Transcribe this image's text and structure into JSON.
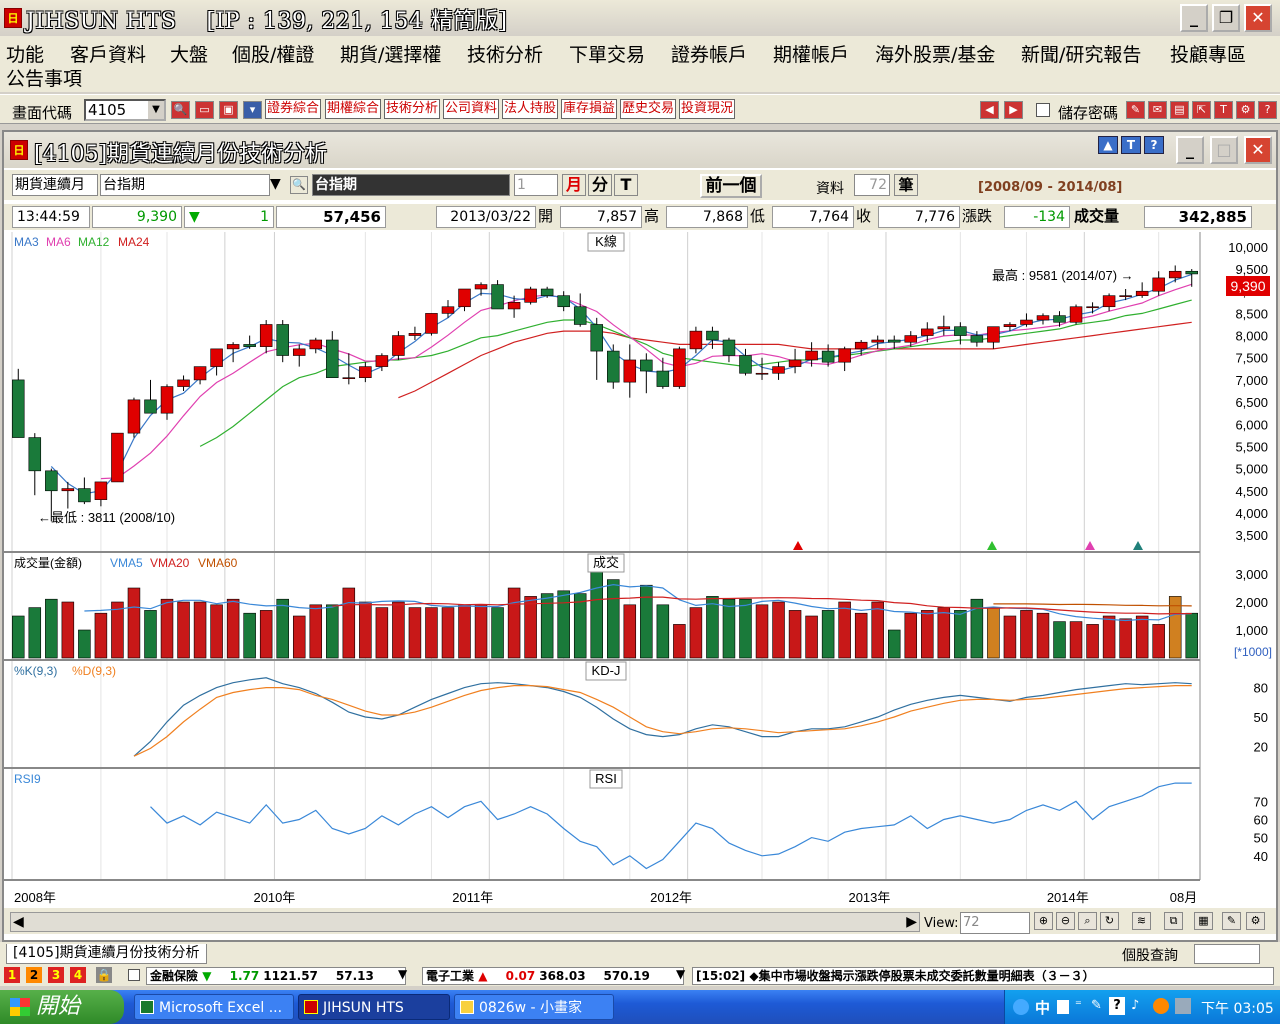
{
  "app": {
    "title": "JIHSUN HTS",
    "subtitle": "[IP : 139, 221, 154 精簡版]",
    "icon": "app-logo-icon"
  },
  "menu": [
    "功能",
    "客戶資料",
    "大盤",
    "個股/權證",
    "期貨/選擇權",
    "技術分析",
    "下單交易",
    "證券帳戶",
    "期權帳戶",
    "海外股票/基金",
    "新聞/研究報告",
    "投顧專區",
    "公告事項"
  ],
  "toolbar": {
    "code_label": "畫面代碼",
    "code_value": "4105",
    "shortcuts": [
      "證券綜合",
      "期權綜合",
      "技術分析",
      "公司資料",
      "法人持股",
      "庫存損益",
      "歷史交易",
      "投資現況"
    ],
    "save_password": "儲存密碼"
  },
  "child": {
    "title": "[4105]期貨連續月份技術分析",
    "type_select": "期貨連續月",
    "symbol_select": "台指期",
    "symbol_name": "台指期",
    "period_value": "1",
    "period_month": "月",
    "period_minute": "分",
    "period_tick": "T",
    "prev_button": "前一個",
    "data_label": "資料",
    "data_count": "72",
    "data_unit": "筆",
    "date_range": "[2008/09 - 2014/08]"
  },
  "quote": {
    "time": "13:44:59",
    "price": "9,390",
    "change_arrow": "▼",
    "change_qty": "1",
    "total": "57,456",
    "date": "2013/03/22",
    "open_label": "開",
    "open": "7,857",
    "high_label": "高",
    "high": "7,868",
    "low_label": "低",
    "low": "7,764",
    "close_label": "收",
    "close": "7,776",
    "change_label": "漲跌",
    "change": "-134",
    "volume_label": "成交量",
    "volume": "342,885"
  },
  "panels": {
    "k": {
      "legend": [
        "MA3",
        "MA6",
        "MA12",
        "MA24"
      ],
      "label": "K線",
      "high_note": "最高 : 9581 (2014/07)",
      "low_note": "最低 : 3811 (2008/10)",
      "last_price": "9,390"
    },
    "vol": {
      "legend_main": "成交量(金額)",
      "legend": [
        "VMA5",
        "VMA20",
        "VMA60"
      ],
      "label": "成交",
      "unit": "[*1000]"
    },
    "kd": {
      "legend": [
        "%K(9,3)",
        "%D(9,3)"
      ],
      "label": "KD-J"
    },
    "rsi": {
      "legend": [
        "RSI9"
      ],
      "label": "RSI"
    }
  },
  "colors": {
    "up": "#e00000",
    "down": "#1a7a3a",
    "ma3": "#3a78c8",
    "ma6": "#e040b0",
    "ma12": "#30b030",
    "ma24": "#d02020",
    "k": "#3070a0",
    "d": "#f08020"
  },
  "chart_data": [
    {
      "type": "candlestick",
      "title": "K線",
      "x": [
        "2008/09",
        "2008/10",
        "2008/11",
        "2008/12",
        "2009/01",
        "2009/02",
        "2009/03",
        "2009/04",
        "2009/05",
        "2009/06",
        "2009/07",
        "2009/08",
        "2009/09",
        "2009/10",
        "2009/11",
        "2009/12",
        "2010/01",
        "2010/02",
        "2010/03",
        "2010/04",
        "2010/05",
        "2010/06",
        "2010/07",
        "2010/08",
        "2010/09",
        "2010/10",
        "2010/11",
        "2010/12",
        "2011/01",
        "2011/02",
        "2011/03",
        "2011/04",
        "2011/05",
        "2011/06",
        "2011/07",
        "2011/08",
        "2011/09",
        "2011/10",
        "2011/11",
        "2011/12",
        "2012/01",
        "2012/02",
        "2012/03",
        "2012/04",
        "2012/05",
        "2012/06",
        "2012/07",
        "2012/08",
        "2012/09",
        "2012/10",
        "2012/11",
        "2012/12",
        "2013/01",
        "2013/02",
        "2013/03",
        "2013/04",
        "2013/05",
        "2013/06",
        "2013/07",
        "2013/08",
        "2013/09",
        "2013/10",
        "2013/11",
        "2013/12",
        "2014/01",
        "2014/02",
        "2014/03",
        "2014/04",
        "2014/05",
        "2014/06",
        "2014/07",
        "2014/08"
      ],
      "open": [
        7000,
        5700,
        4950,
        4500,
        4550,
        4300,
        4700,
        5800,
        6550,
        6250,
        6850,
        7000,
        7300,
        7700,
        7800,
        7750,
        8250,
        7550,
        7700,
        7900,
        7050,
        7050,
        7300,
        7550,
        8000,
        8050,
        8500,
        8650,
        9050,
        9150,
        8600,
        8750,
        9050,
        8900,
        8650,
        8250,
        7650,
        6950,
        7450,
        7200,
        6850,
        7700,
        8100,
        7900,
        7550,
        7150,
        7150,
        7300,
        7450,
        7650,
        7400,
        7700,
        7850,
        7900,
        7850,
        8000,
        8150,
        8200,
        8000,
        7850,
        8200,
        8250,
        8350,
        8450,
        8300,
        8650,
        8650,
        8900,
        8900,
        9000,
        9300,
        9450
      ],
      "high": [
        7250,
        5800,
        5000,
        4700,
        4800,
        4500,
        5800,
        6600,
        7000,
        6900,
        7100,
        7300,
        7600,
        7850,
        8000,
        8350,
        8350,
        7800,
        7950,
        8100,
        7600,
        7400,
        7600,
        8100,
        8200,
        8500,
        8800,
        9050,
        9200,
        9250,
        8900,
        9100,
        9100,
        9000,
        8950,
        8400,
        7800,
        7800,
        7600,
        7500,
        7750,
        8200,
        8200,
        7950,
        7700,
        7500,
        7400,
        7700,
        7850,
        7800,
        7750,
        7900,
        8000,
        8000,
        8100,
        8300,
        8450,
        8300,
        8100,
        8200,
        8300,
        8500,
        8500,
        8550,
        8700,
        8750,
        8950,
        9050,
        9200,
        9450,
        9581,
        9500
      ],
      "low": [
        5700,
        4400,
        3811,
        4100,
        4200,
        4150,
        4700,
        5700,
        6300,
        6100,
        6750,
        6900,
        7100,
        7400,
        7700,
        7600,
        7400,
        7300,
        7600,
        7050,
        6900,
        6950,
        7200,
        7450,
        7900,
        8000,
        8400,
        8550,
        8900,
        8600,
        8400,
        8700,
        8850,
        8550,
        8200,
        7000,
        6800,
        6600,
        6700,
        6800,
        6800,
        7600,
        7700,
        7400,
        7100,
        7000,
        7000,
        7150,
        7300,
        7300,
        7200,
        7550,
        7700,
        7700,
        7750,
        7850,
        8000,
        7800,
        7750,
        7700,
        8100,
        8200,
        8250,
        8200,
        8250,
        8500,
        8550,
        8800,
        8850,
        8900,
        9200,
        9100
      ],
      "close": [
        5700,
        4950,
        4500,
        4550,
        4250,
        4700,
        5800,
        6550,
        6250,
        6850,
        7000,
        7300,
        7700,
        7800,
        7750,
        8250,
        7550,
        7700,
        7900,
        7050,
        7050,
        7300,
        7550,
        8000,
        8050,
        8500,
        8650,
        9050,
        9150,
        8600,
        8750,
        9050,
        8900,
        8650,
        8250,
        7650,
        6950,
        7450,
        7200,
        6850,
        7700,
        8100,
        7900,
        7550,
        7150,
        7150,
        7300,
        7450,
        7650,
        7400,
        7700,
        7850,
        7900,
        7850,
        8000,
        8150,
        8200,
        8000,
        7850,
        8200,
        8250,
        8350,
        8450,
        8300,
        8650,
        8650,
        8900,
        8900,
        9000,
        9300,
        9450,
        9390
      ],
      "ma12": [
        null,
        null,
        null,
        null,
        null,
        null,
        null,
        null,
        null,
        null,
        null,
        5500,
        5700,
        5950,
        6250,
        6550,
        6850,
        7050,
        7150,
        7300,
        7350,
        7400,
        7450,
        7450,
        7500,
        7550,
        7650,
        7800,
        7950,
        8000,
        8100,
        8200,
        8300,
        8350,
        8350,
        8250,
        8100,
        7950,
        7800,
        7600,
        7500,
        7450,
        7400,
        7350,
        7300,
        7350,
        7400,
        7450,
        7450,
        7500,
        7550,
        7600,
        7650,
        7700,
        7750,
        7800,
        7850,
        7900,
        7900,
        7950,
        8000,
        8050,
        8100,
        8150,
        8250,
        8300,
        8350,
        8450,
        8500,
        8600,
        8700,
        8800
      ],
      "ma24": [
        null,
        null,
        null,
        null,
        null,
        null,
        null,
        null,
        null,
        null,
        null,
        null,
        null,
        null,
        null,
        null,
        null,
        null,
        null,
        null,
        null,
        null,
        null,
        6600,
        6750,
        6950,
        7150,
        7350,
        7550,
        7700,
        7850,
        7950,
        8050,
        8100,
        8100,
        8100,
        8050,
        7950,
        7900,
        7850,
        7800,
        7800,
        7800,
        7800,
        7800,
        7800,
        7800,
        7750,
        7700,
        7700,
        7700,
        7700,
        7700,
        7700,
        7700,
        7700,
        7700,
        7700,
        7700,
        7700,
        7750,
        7800,
        7850,
        7900,
        7950,
        8000,
        8050,
        8100,
        8150,
        8200,
        8250,
        8300
      ],
      "ylim": [
        3300,
        10200
      ],
      "yticks": [
        "10,000",
        "9,500",
        "9,000",
        "8,500",
        "8,000",
        "7,500",
        "7,000",
        "6,500",
        "6,000",
        "5,500",
        "5,000",
        "4,500",
        "4,000",
        "3,500"
      ]
    },
    {
      "type": "bar",
      "title": "成交",
      "values": [
        1500,
        1800,
        2100,
        2000,
        1000,
        1600,
        2000,
        2500,
        1700,
        2100,
        2000,
        2000,
        1900,
        2100,
        1600,
        1700,
        2100,
        1500,
        1900,
        1900,
        2500,
        2000,
        1800,
        2000,
        1800,
        1800,
        1800,
        1900,
        1900,
        1800,
        2500,
        2200,
        2300,
        2400,
        2300,
        3300,
        2800,
        1900,
        2600,
        1900,
        1200,
        1800,
        2200,
        2100,
        2100,
        1900,
        2000,
        1700,
        1500,
        1700,
        2000,
        1600,
        2000,
        1000,
        1600,
        1700,
        1800,
        1700,
        2100,
        1800,
        1500,
        1700,
        1600,
        1300,
        1300,
        1200,
        1500,
        1400,
        1500,
        1200,
        2200,
        1600
      ],
      "yticks": [
        "3,000",
        "2,000",
        "1,000"
      ],
      "unit": "[*1000]"
    },
    {
      "type": "line",
      "title": "KD-J",
      "series": [
        {
          "name": "%K(9,3)",
          "values": [
            null,
            null,
            null,
            null,
            null,
            null,
            null,
            10,
            25,
            45,
            62,
            72,
            80,
            85,
            88,
            90,
            84,
            80,
            74,
            65,
            55,
            50,
            48,
            52,
            60,
            68,
            74,
            80,
            84,
            85,
            84,
            82,
            80,
            76,
            70,
            60,
            48,
            38,
            32,
            30,
            32,
            38,
            42,
            40,
            35,
            30,
            30,
            35,
            38,
            38,
            40,
            45,
            50,
            57,
            63,
            67,
            70,
            72,
            70,
            68,
            66,
            70,
            72,
            75,
            78,
            80,
            82,
            84,
            83,
            84,
            85,
            84
          ]
        },
        {
          "name": "%D(9,3)",
          "values": [
            null,
            null,
            null,
            null,
            null,
            null,
            null,
            10,
            18,
            30,
            45,
            58,
            70,
            75,
            78,
            80,
            80,
            78,
            72,
            68,
            62,
            56,
            52,
            52,
            55,
            60,
            66,
            72,
            77,
            80,
            82,
            82,
            81,
            78,
            75,
            68,
            60,
            50,
            40,
            35,
            33,
            35,
            38,
            39,
            38,
            36,
            34,
            35,
            36,
            37,
            38,
            41,
            45,
            50,
            56,
            60,
            64,
            67,
            68,
            68,
            67,
            68,
            69,
            71,
            73,
            75,
            77,
            79,
            80,
            81,
            82,
            82
          ]
        }
      ],
      "yticks": [
        "80",
        "50",
        "20"
      ]
    },
    {
      "type": "line",
      "title": "RSI",
      "series": [
        {
          "name": "RSI9",
          "values": [
            null,
            null,
            null,
            null,
            null,
            null,
            null,
            null,
            67,
            58,
            62,
            57,
            64,
            61,
            58,
            68,
            58,
            60,
            65,
            55,
            52,
            55,
            62,
            57,
            63,
            67,
            61,
            67,
            70,
            60,
            63,
            67,
            63,
            55,
            48,
            45,
            35,
            40,
            33,
            38,
            48,
            58,
            55,
            47,
            43,
            40,
            41,
            45,
            50,
            48,
            53,
            55,
            56,
            57,
            62,
            55,
            60,
            62,
            60,
            58,
            60,
            65,
            68,
            65,
            70,
            60,
            67,
            70,
            73,
            78,
            80,
            80
          ]
        }
      ],
      "yticks": [
        "70",
        "60",
        "50",
        "40"
      ]
    }
  ],
  "xaxis": {
    "labels": [
      "2008年",
      "2010年",
      "2011年",
      "2012年",
      "2013年",
      "2014年",
      "08月"
    ]
  },
  "scroll": {
    "view_label": "View:",
    "view_value": "72"
  },
  "tabs": {
    "active": "[4105]期貨連續月份技術分析",
    "right_label": "個股查詢"
  },
  "status": {
    "nums": [
      "1",
      "2",
      "3",
      "4"
    ],
    "s1_name": "金融保險",
    "s1_arrow": "▼",
    "s1_chg": "1.77",
    "s1_val": "1121.57",
    "s1_val2": "57.13",
    "s2_name": "電子工業",
    "s2_arrow": "▲",
    "s2_chg": "0.07",
    "s2_val": "368.03",
    "s2_val2": "570.19",
    "news_time": "[15:02]",
    "news": "◆集中市場收盤揭示漲跌停股票未成交委託數量明細表（３－３）"
  },
  "taskbar": {
    "start": "開始",
    "tasks": [
      "Microsoft Excel ...",
      "JIHSUN HTS",
      "0826w - 小畫家"
    ],
    "ime": "中",
    "clock": "下午 03:05"
  }
}
